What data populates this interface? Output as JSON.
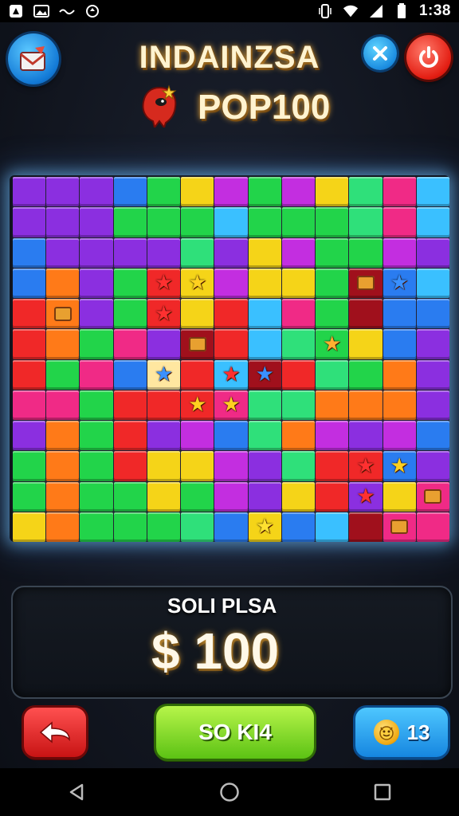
{
  "status_bar": {
    "time": "1:38",
    "left_icons": [
      "app-icon",
      "image-icon",
      "dots-icon",
      "sync-icon"
    ],
    "right_icons": [
      "vibrate-icon",
      "wifi-icon",
      "cellular-icon",
      "battery-icon"
    ]
  },
  "header": {
    "title": "INDAINZSA",
    "subtitle": "POP100",
    "mail_icon": "mail-icon",
    "close_icon": "close-icon",
    "power_icon": "power-icon"
  },
  "board": {
    "columns": 13,
    "rows": 12,
    "palette": {
      "P": "#8b2fe0",
      "B": "#2a7cf0",
      "G": "#22d44a",
      "Y": "#f5d418",
      "M": "#c32ee0",
      "C": "#2fe07a",
      "R": "#f02828",
      "O": "#ff7a18",
      "K": "#f02a86",
      "L": "#3ac0ff",
      "D": "#a0101c",
      "W": "#ffe7a0"
    },
    "cells": [
      "PPPBGYMGMYCKL",
      "PPPGGGLGGGCKL",
      "BPPPPCPYMGGMP",
      "BOPGRYMYYGDBL",
      "ROPGRYRLKGDBB",
      "ROGKPDRLCGYBP",
      "RGKBWRLDRCGOP",
      "KKGRRRKCCOOOP",
      "POGRPMBCOMPMB",
      "GOGRYYMPCRRBP",
      "GOGGYGMPYRPYK",
      "YOGGGCBYBLDKK"
    ],
    "stars": [
      {
        "row": 3,
        "col": 4,
        "color": "#ff3030"
      },
      {
        "row": 3,
        "col": 5,
        "color": "#ffd020"
      },
      {
        "row": 3,
        "col": 11,
        "color": "#3a90ff"
      },
      {
        "row": 4,
        "col": 4,
        "color": "#ff3030"
      },
      {
        "row": 5,
        "col": 9,
        "color": "#ffb030"
      },
      {
        "row": 6,
        "col": 4,
        "color": "#3a90ff"
      },
      {
        "row": 6,
        "col": 6,
        "color": "#ff3030"
      },
      {
        "row": 6,
        "col": 7,
        "color": "#3a90ff"
      },
      {
        "row": 7,
        "col": 5,
        "color": "#ffd020"
      },
      {
        "row": 7,
        "col": 6,
        "color": "#ffd020"
      },
      {
        "row": 9,
        "col": 10,
        "color": "#ff3030"
      },
      {
        "row": 9,
        "col": 11,
        "color": "#ffd020"
      },
      {
        "row": 10,
        "col": 10,
        "color": "#ff3030"
      },
      {
        "row": 11,
        "col": 7,
        "color": "#ffe030"
      }
    ],
    "items": [
      {
        "row": 4,
        "col": 1
      },
      {
        "row": 3,
        "col": 10
      },
      {
        "row": 5,
        "col": 5
      },
      {
        "row": 10,
        "col": 12
      },
      {
        "row": 11,
        "col": 11
      }
    ]
  },
  "score_panel": {
    "label": "SOLI PLSA",
    "value": "$ 100"
  },
  "bottom": {
    "back_icon": "back-arrow-icon",
    "play_label": "SO KI4",
    "coin_icon": "coin-icon",
    "coins": "13"
  },
  "nav_bar": {
    "back_icon": "nav-back-icon",
    "home_icon": "nav-home-icon",
    "recents_icon": "nav-recents-icon"
  }
}
